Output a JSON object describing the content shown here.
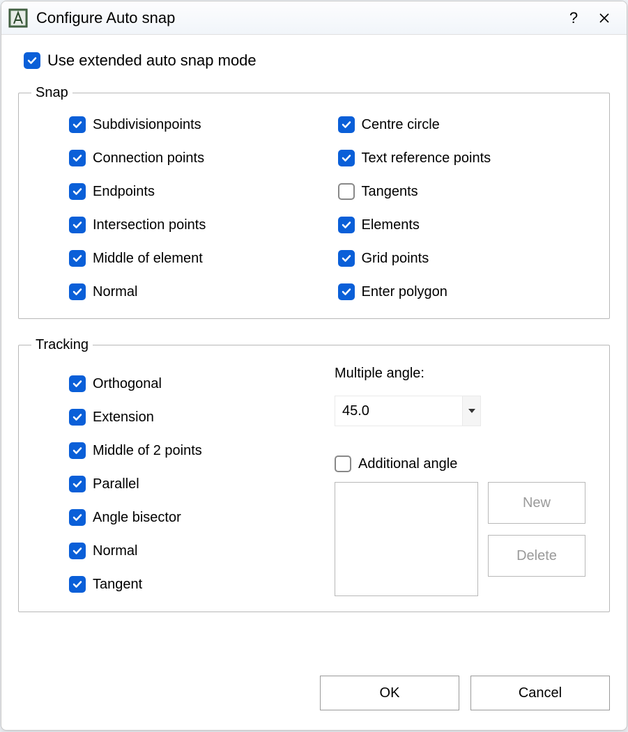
{
  "titlebar": {
    "title": "Configure Auto snap"
  },
  "extended_mode": {
    "label": "Use extended auto snap mode",
    "checked": true
  },
  "snap": {
    "legend": "Snap",
    "left": [
      {
        "label": "Subdivisionpoints",
        "checked": true
      },
      {
        "label": "Connection points",
        "checked": true
      },
      {
        "label": "Endpoints",
        "checked": true
      },
      {
        "label": "Intersection points",
        "checked": true
      },
      {
        "label": "Middle of element",
        "checked": true
      },
      {
        "label": "Normal",
        "checked": true
      }
    ],
    "right": [
      {
        "label": "Centre circle",
        "checked": true
      },
      {
        "label": "Text reference points",
        "checked": true
      },
      {
        "label": "Tangents",
        "checked": false
      },
      {
        "label": "Elements",
        "checked": true
      },
      {
        "label": "Grid points",
        "checked": true
      },
      {
        "label": "Enter polygon",
        "checked": true
      }
    ]
  },
  "tracking": {
    "legend": "Tracking",
    "left": [
      {
        "label": "Orthogonal",
        "checked": true
      },
      {
        "label": "Extension",
        "checked": true
      },
      {
        "label": "Middle of 2 points",
        "checked": true
      },
      {
        "label": "Parallel",
        "checked": true
      },
      {
        "label": "Angle bisector",
        "checked": true
      },
      {
        "label": "Normal",
        "checked": true
      },
      {
        "label": "Tangent",
        "checked": true
      }
    ],
    "multiple_angle": {
      "label": "Multiple angle:",
      "value": "45.0"
    },
    "additional_angle": {
      "label": "Additional angle",
      "checked": false
    },
    "new_btn": "New",
    "delete_btn": "Delete"
  },
  "footer": {
    "ok": "OK",
    "cancel": "Cancel"
  }
}
